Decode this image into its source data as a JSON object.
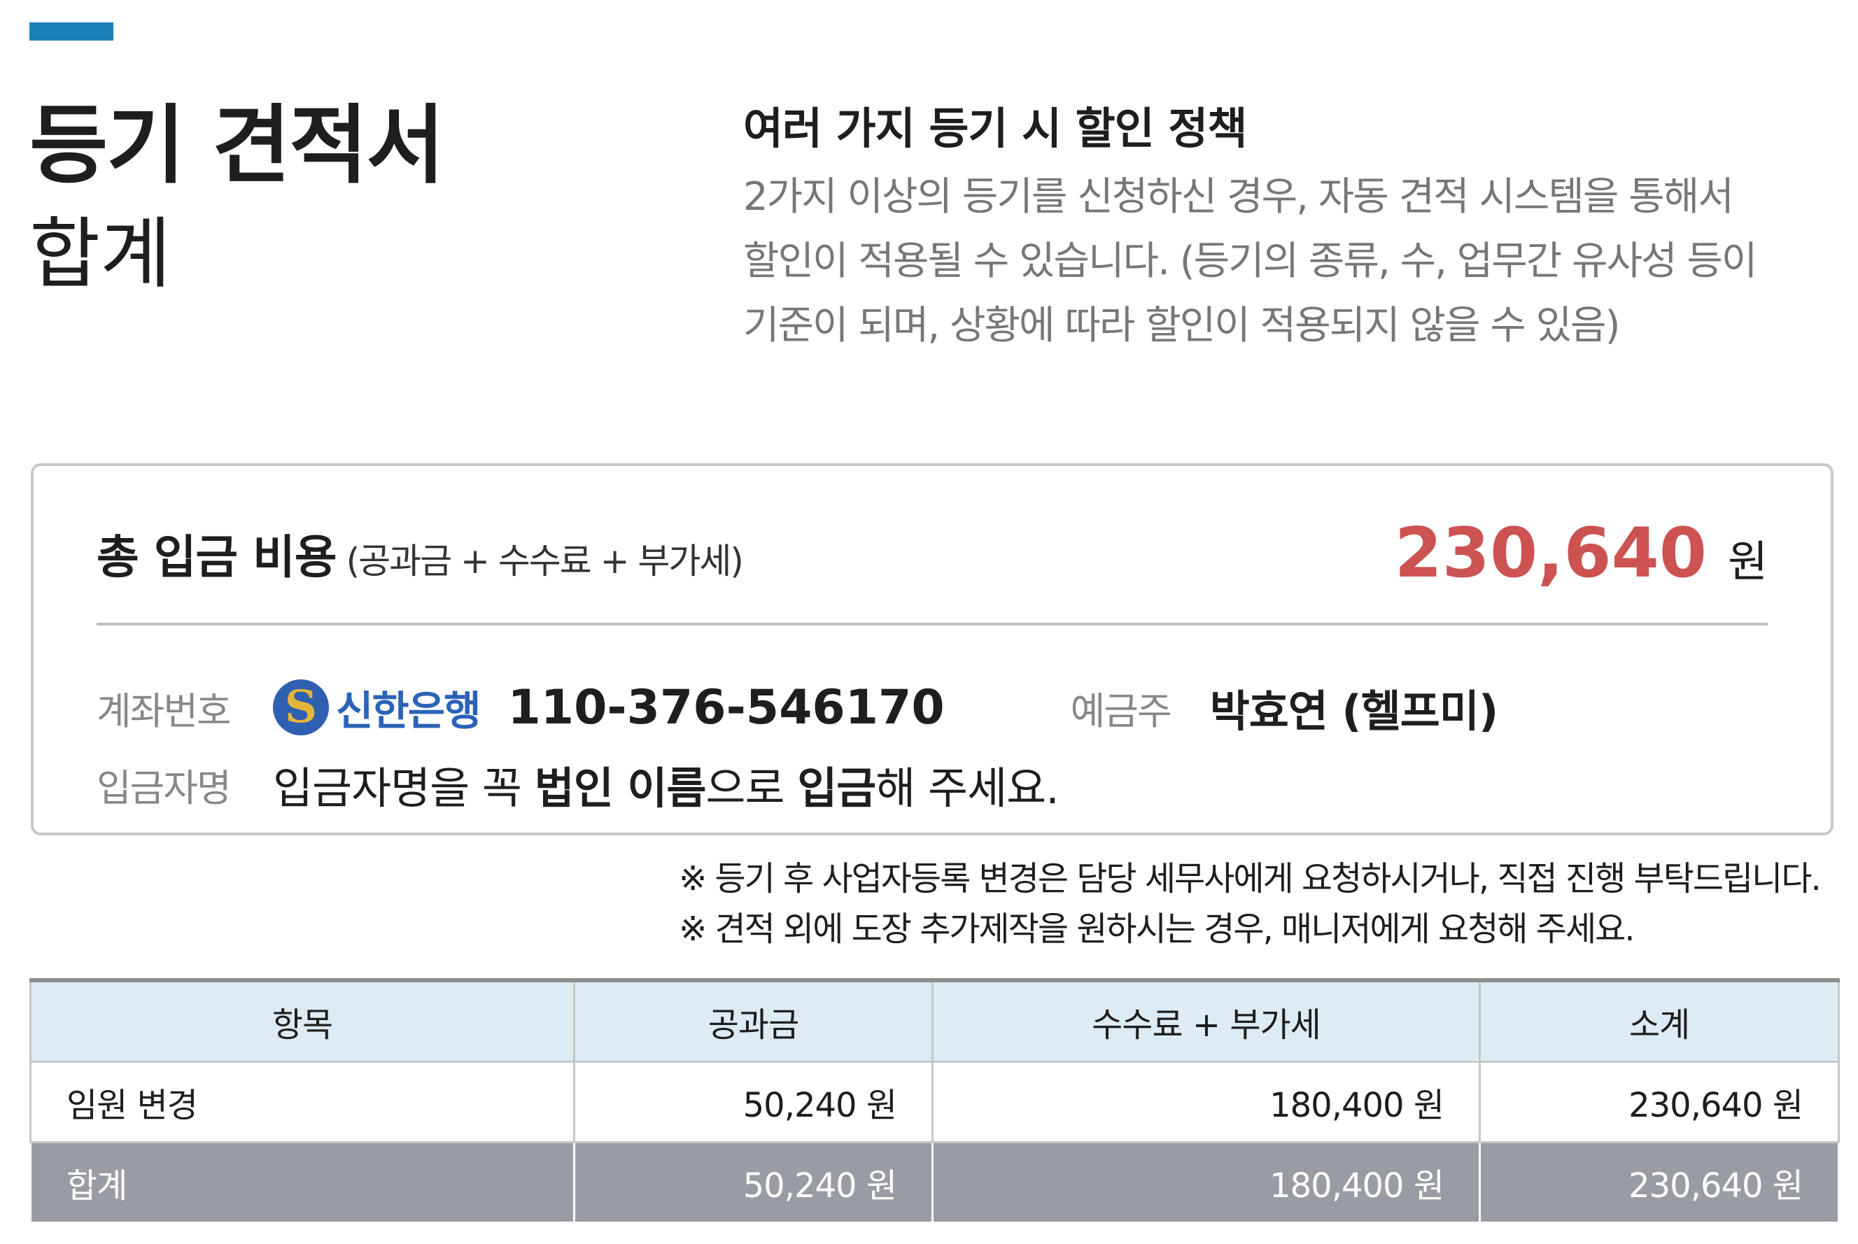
{
  "header": {
    "title": "등기 견적서",
    "subtitle": "합계"
  },
  "policy": {
    "title": "여러 가지 등기 시 할인 정책",
    "lines": [
      "2가지 이상의 등기를 신청하신 경우, 자동 견적 시스템을 통해서",
      "할인이 적용될 수 있습니다. (등기의 종류, 수, 업무간 유사성 등이",
      "기준이 되며, 상황에 따라 할인이 적용되지 않을 수 있음)"
    ]
  },
  "payment": {
    "total_label": "총 입금 비용",
    "total_note": "(공과금 + 수수료 + 부가세)",
    "total_amount": "230,640",
    "total_unit": "원",
    "account_label": "계좌번호",
    "bank_logo_icon": "shinhan-bank-logo-icon",
    "bank_name": "신한은행",
    "account_number": "110-376-546170",
    "holder_label": "예금주",
    "holder_name": "박효연 (헬프미)",
    "depositor_label": "입금자명",
    "depositor_parts": [
      "입금자명을 꼭 ",
      "법인 이름",
      "으로 ",
      "입금",
      "해 주세요."
    ]
  },
  "notes": [
    "※ 등기 후 사업자등록 변경은 담당 세무사에게 요청하시거나, 직접 진행 부탁드립니다.",
    "※ 견적 외에 도장 추가제작을 원하시는 경우, 매니저에게 요청해 주세요."
  ],
  "table": {
    "headers": [
      "항목",
      "공과금",
      "수수료 + 부가세",
      "소계"
    ],
    "rows": [
      [
        "임원 변경",
        "50,240 원",
        "180,400 원",
        "230,640 원"
      ]
    ],
    "total_row": [
      "합계",
      "50,240 원",
      "180,400 원",
      "230,640 원"
    ]
  },
  "colors": {
    "accent": "#1b7fb9",
    "amount": "#cd5252",
    "header_bg": "#dcebf4",
    "total_bg": "#9a9ca4"
  }
}
